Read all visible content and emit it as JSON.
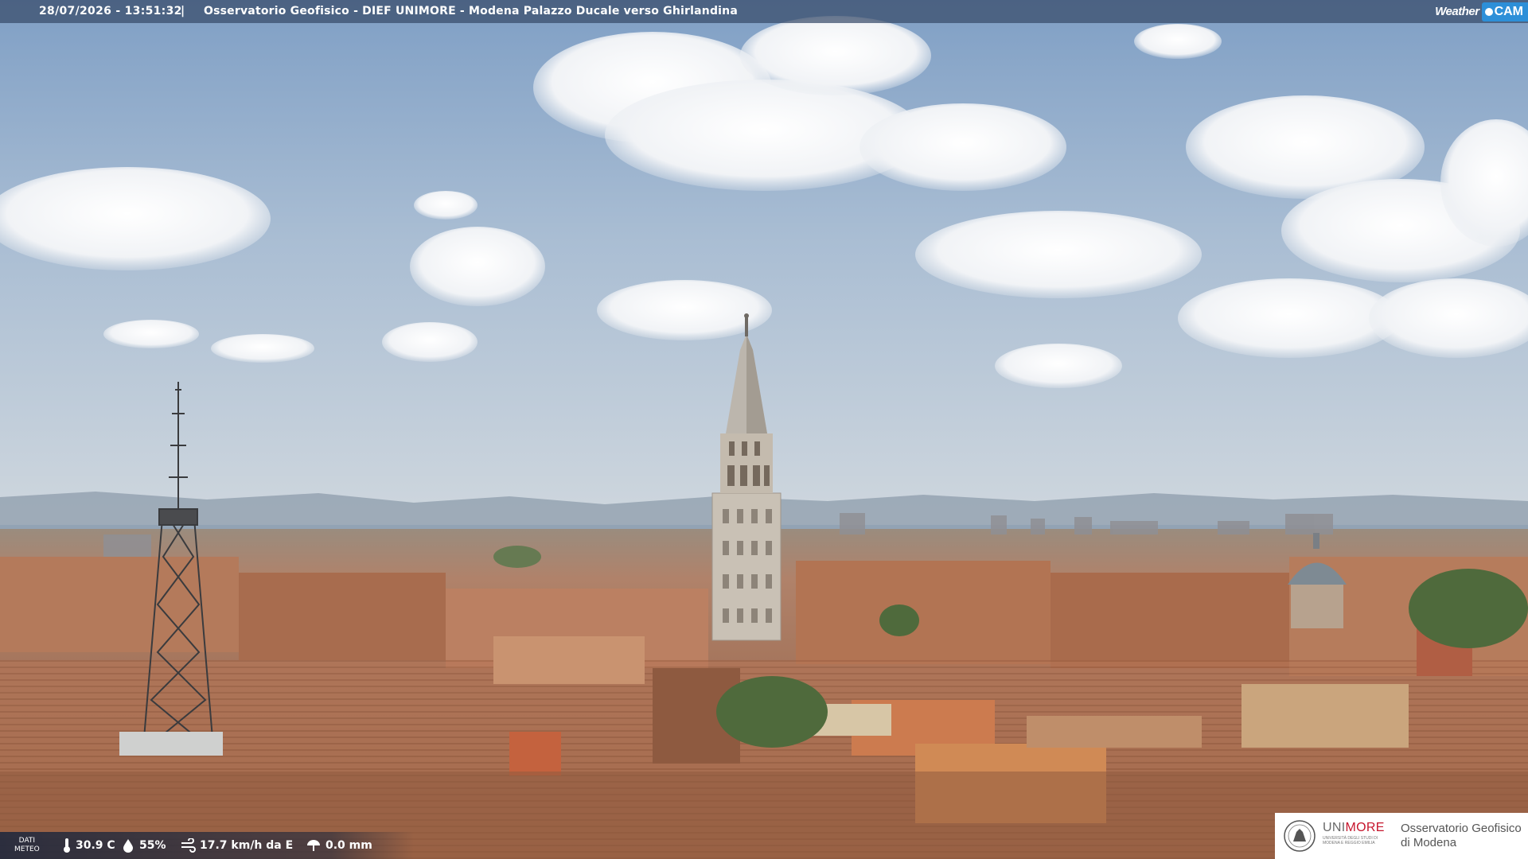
{
  "overlay": {
    "timestamp": "28/07/2026 - 13:51:32",
    "separator": "|",
    "title": "Osservatorio Geofisico - DIEF UNIMORE - Modena Palazzo Ducale verso Ghirlandina"
  },
  "brand": {
    "weather": "Weather",
    "cam": "CAM"
  },
  "meteo": {
    "label_line1": "DATI",
    "label_line2": "METEO",
    "temperature": "30.9 C",
    "humidity": "55%",
    "wind": "17.7 km/h da E",
    "rain": "0.0 mm"
  },
  "logo": {
    "uni": "UNI",
    "more": "MORE",
    "subtitle": "UNIVERSITÀ DEGLI STUDI DI MODENA E REGGIO EMILIA",
    "observatory_line1": "Osservatorio Geofisico",
    "observatory_line2": "di Modena"
  },
  "colors": {
    "sky_top": "#7f9fc5",
    "sky_horizon": "#c9d3dc",
    "roofs": "#b77a58",
    "bar_bg": "#374b69",
    "cam_accent": "#2d8fd8",
    "unimore_red": "#c6152c"
  },
  "icons": [
    "thermometer-icon",
    "humidity-drop-icon",
    "wind-icon",
    "rain-gauge-icon",
    "university-seal-icon"
  ]
}
